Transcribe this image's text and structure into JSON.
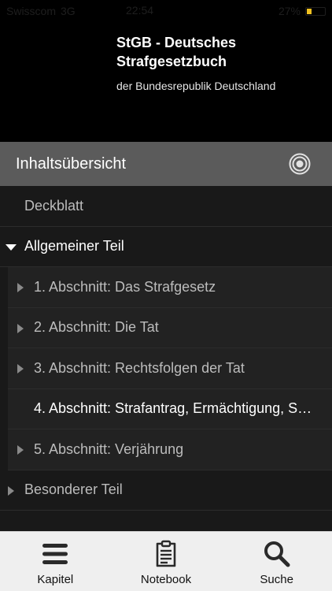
{
  "status_bar": {
    "carrier": "Swisscom",
    "network": "3G",
    "time": "22:54",
    "battery_text": "27%",
    "battery_level": 0.27,
    "battery_color": "#f0c020"
  },
  "header": {
    "title": "StGB - Deutsches Strafgesetzbuch",
    "subtitle": "der Bundesrepublik Deutschland"
  },
  "toc": {
    "title": "Inhaltsübersicht",
    "icon": "target-icon"
  },
  "list": {
    "items": [
      {
        "label": "Deckblatt"
      },
      {
        "label": "Allgemeiner Teil"
      },
      {
        "label": "1. Abschnitt: Das Strafgesetz"
      },
      {
        "label": "2. Abschnitt: Die Tat"
      },
      {
        "label": "3. Abschnitt: Rechtsfolgen der Tat"
      },
      {
        "label": "4. Abschnitt: Strafantrag, Ermächtigung, S…"
      },
      {
        "label": "5. Abschnitt: Verjährung"
      },
      {
        "label": "Besonderer Teil"
      }
    ]
  },
  "tabbar": {
    "tabs": [
      {
        "label": "Kapitel",
        "icon": "menu-icon"
      },
      {
        "label": "Notebook",
        "icon": "notebook-icon"
      },
      {
        "label": "Suche",
        "icon": "search-icon"
      }
    ]
  }
}
